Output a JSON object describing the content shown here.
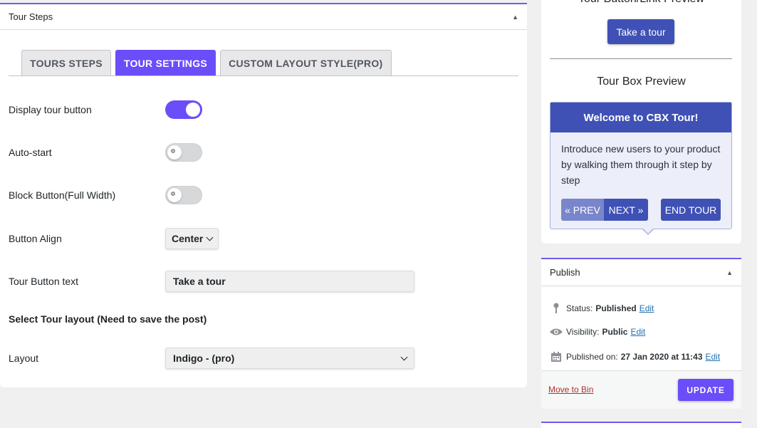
{
  "colors": {
    "accent": "#6b4dfa",
    "indigo": "#3f51b5",
    "indigo_light": "#7986cb",
    "link": "#2271b1",
    "danger": "#b32d2e"
  },
  "tour_steps_panel": {
    "title": "Tour Steps",
    "collapse_icon": "triangle-up-icon",
    "tabs": [
      {
        "label": "TOURS STEPS",
        "active": false
      },
      {
        "label": "TOUR SETTINGS",
        "active": true
      },
      {
        "label": "CUSTOM LAYOUT STYLE(PRO)",
        "active": false
      }
    ],
    "settings": {
      "display_tour_button": {
        "label": "Display tour button",
        "enabled": true
      },
      "auto_start": {
        "label": "Auto-start",
        "enabled": false
      },
      "block_button": {
        "label": "Block Button(Full Width)",
        "enabled": false
      },
      "button_align": {
        "label": "Button Align",
        "value": "Center"
      },
      "tour_button_text": {
        "label": "Tour Button text",
        "value": "Take a tour"
      },
      "layout_heading": "Select Tour layout (Need to save the post)",
      "layout": {
        "label": "Layout",
        "value": "Indigo - (pro)"
      }
    }
  },
  "preview_panel": {
    "button_link_heading": "Tour Button/Link Preview",
    "take_tour_button": "Take a tour",
    "tour_box_heading": "Tour Box Preview",
    "tour_box": {
      "title": "Welcome to CBX Tour!",
      "body": "Introduce new users to your product by walking them through it step by step",
      "prev": "« PREV",
      "next": "NEXT »",
      "end": "END TOUR"
    }
  },
  "publish_panel": {
    "title": "Publish",
    "collapse_icon": "triangle-up-icon",
    "status": {
      "label": "Status:",
      "value": "Published",
      "edit": "Edit",
      "icon": "pin-icon"
    },
    "visibility": {
      "label": "Visibility:",
      "value": "Public",
      "edit": "Edit",
      "icon": "eye-icon"
    },
    "published_on": {
      "label": "Published on:",
      "value": "27 Jan 2020 at 11:43",
      "edit": "Edit",
      "icon": "calendar-icon"
    },
    "move_to_bin": "Move to Bin",
    "update": "UPDATE"
  }
}
